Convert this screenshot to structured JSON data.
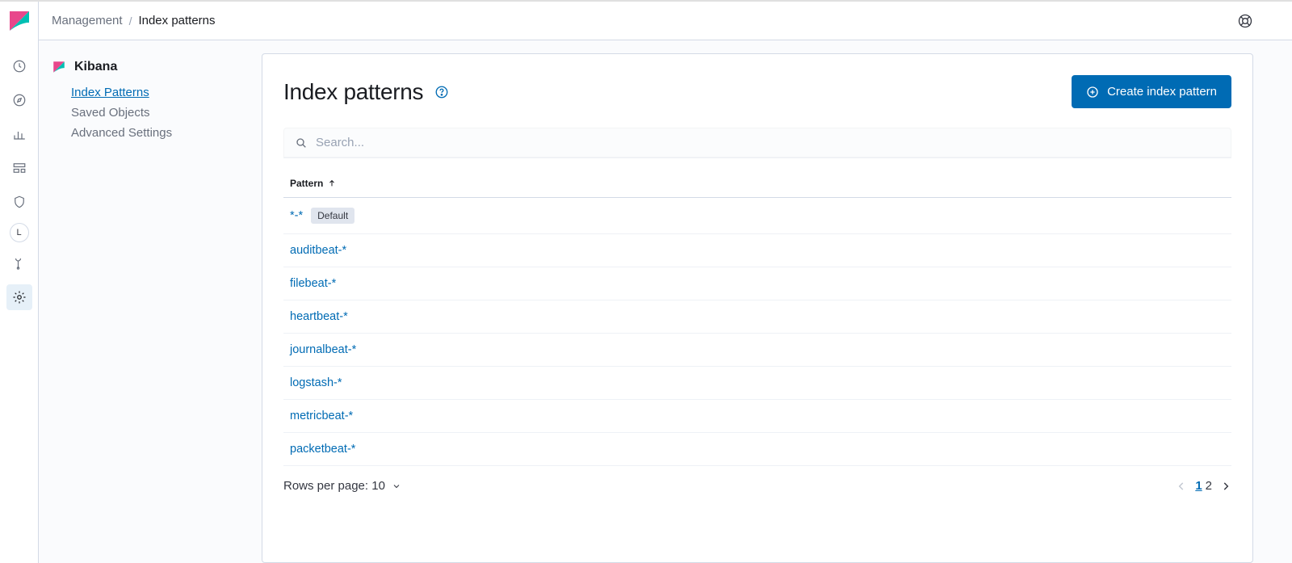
{
  "breadcrumb": {
    "parent": "Management",
    "current": "Index patterns"
  },
  "sidebar": {
    "section": "Kibana",
    "items": [
      {
        "label": "Index Patterns",
        "active": true
      },
      {
        "label": "Saved Objects",
        "active": false
      },
      {
        "label": "Advanced Settings",
        "active": false
      }
    ]
  },
  "page": {
    "title": "Index patterns",
    "create_button": "Create index pattern",
    "search_placeholder": "Search..."
  },
  "table": {
    "column_header": "Pattern",
    "default_badge": "Default",
    "rows": [
      {
        "pattern": "*-*",
        "default": true
      },
      {
        "pattern": "auditbeat-*",
        "default": false
      },
      {
        "pattern": "filebeat-*",
        "default": false
      },
      {
        "pattern": "heartbeat-*",
        "default": false
      },
      {
        "pattern": "journalbeat-*",
        "default": false
      },
      {
        "pattern": "logstash-*",
        "default": false
      },
      {
        "pattern": "metricbeat-*",
        "default": false
      },
      {
        "pattern": "packetbeat-*",
        "default": false
      }
    ]
  },
  "footer": {
    "rows_per_page_label": "Rows per page: 10",
    "current_page": 1,
    "pages": [
      "1",
      "2"
    ]
  },
  "nav_letter": "L"
}
